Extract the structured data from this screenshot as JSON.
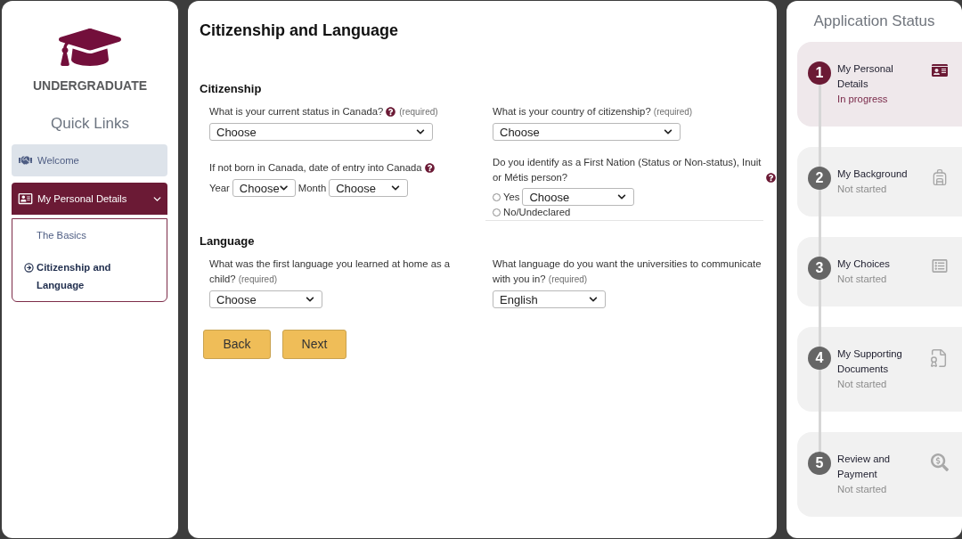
{
  "sidebar": {
    "logo_caption": "UNDERGRADUATE",
    "heading": "Quick Links",
    "items": [
      {
        "label": "Welcome",
        "expanded": false
      },
      {
        "label": "My Personal Details",
        "expanded": true,
        "children": [
          {
            "label": "The Basics",
            "selected": false
          },
          {
            "label": "Citizenship and Language",
            "selected": true
          }
        ]
      }
    ]
  },
  "form": {
    "title": "Citizenship and Language",
    "sections": [
      {
        "heading": "Citizenship",
        "fields": [
          {
            "kind": "select",
            "label": "What is your current status in Canada?",
            "help": true,
            "note": "(required)",
            "value": "Choose"
          },
          {
            "kind": "select",
            "label": "What is your country of citizenship?",
            "note": "(required)",
            "value": "Choose"
          },
          {
            "kind": "date",
            "label": "If not born in Canada, date of entry into Canada",
            "help": true,
            "parts": [
              {
                "label": "Year",
                "value": "Choose"
              },
              {
                "label": "Month",
                "value": "Choose"
              }
            ]
          },
          {
            "kind": "radio",
            "label": "Do you identify as a First Nation (Status or Non-status), Inuit or Métis person?",
            "help": true,
            "options": [
              {
                "label": "Yes",
                "selected": false,
                "value": "Choose"
              },
              {
                "label": "No/Undeclared",
                "selected": false
              }
            ]
          }
        ]
      },
      {
        "heading": "Language",
        "fields": [
          {
            "kind": "select",
            "label": "What was the first language you learned at home as a child?",
            "note": "(required)",
            "value": "Choose"
          },
          {
            "kind": "select",
            "label": "What language do you want the universities to communicate with you in?",
            "note": "(required)",
            "value": "English"
          }
        ]
      }
    ],
    "buttons": [
      {
        "label": "Back"
      },
      {
        "label": "Next"
      }
    ]
  },
  "status_panel": {
    "title": "Application Status",
    "steps": [
      {
        "number": "1",
        "title": "My Personal Details",
        "status": "In progress",
        "current": true
      },
      {
        "number": "2",
        "title": "My Background",
        "status": "Not started",
        "current": false
      },
      {
        "number": "3",
        "title": "My Choices",
        "status": "Not started",
        "current": false
      },
      {
        "number": "4",
        "title": "My Supporting Documents",
        "status": "Not started",
        "current": false
      },
      {
        "number": "5",
        "title": "Review and Payment",
        "status": "Not started",
        "current": false
      }
    ]
  }
}
